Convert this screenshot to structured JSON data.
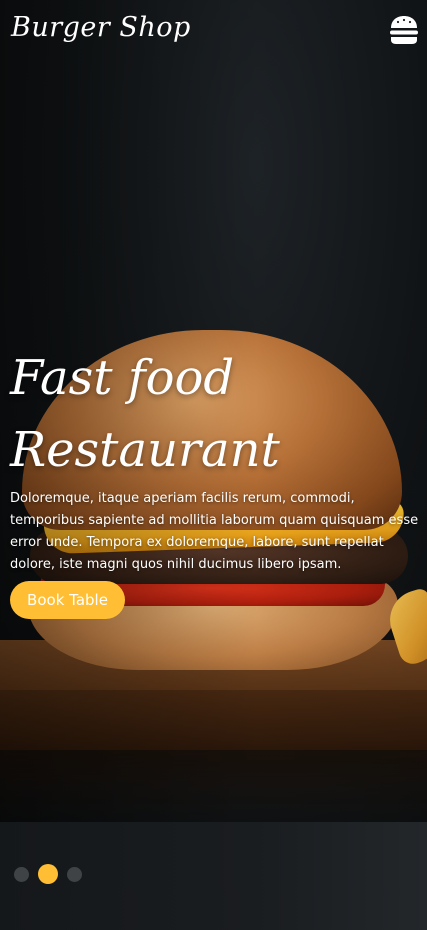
{
  "header": {
    "brand": "Burger Shop",
    "menu_icon": "burger-menu-icon"
  },
  "hero": {
    "title_line1": "Fast food",
    "title_line2": "Restaurant",
    "description": "Doloremque, itaque aperiam facilis rerum, commodi, temporibus sapiente ad mollitia laborum quam quisquam esse error unde. Tempora ex doloremque, labore, sunt repellat dolore, iste magni quos nihil ducimus libero ipsam.",
    "button_label": "Book Table"
  },
  "carousel": {
    "slide_count": 3,
    "active_index": 1
  },
  "colors": {
    "accent": "#ffbe33",
    "dot_inactive": "#3f4346",
    "background": "#1b1e21",
    "text": "#ffffff"
  }
}
